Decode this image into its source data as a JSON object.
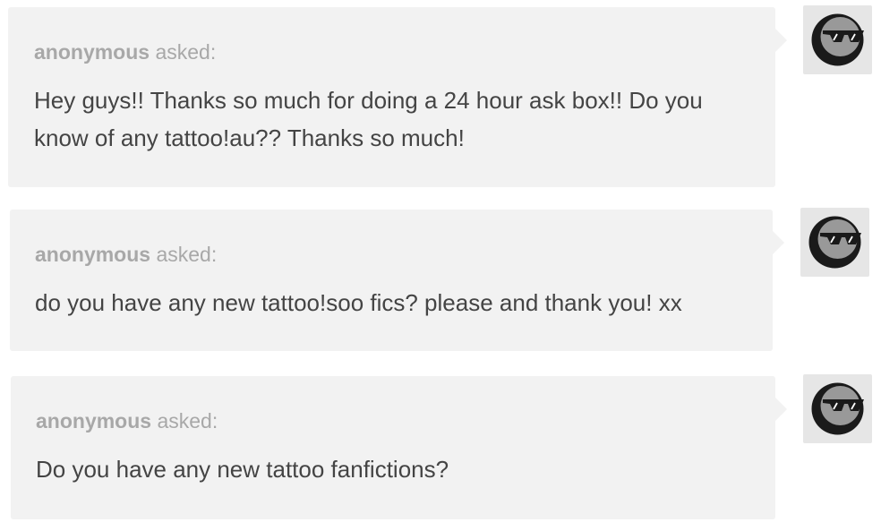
{
  "asks": [
    {
      "asker": "anonymous",
      "asked_label": " asked:",
      "question": "Hey guys!! Thanks so much for doing a 24 hour ask box!! Do you know of any tattoo!au?? Thanks so much!"
    },
    {
      "asker": "anonymous",
      "asked_label": " asked:",
      "question": "do you have any new tattoo!soo fics? please and thank you! xx"
    },
    {
      "asker": "anonymous",
      "asked_label": " asked:",
      "question": "Do you have any new tattoo fanfictions?"
    }
  ],
  "avatar_icon": "anonymous-sunglasses-avatar-icon",
  "colors": {
    "bubble": "#f2f2f2",
    "asker_text": "#a8a8a8",
    "question_text": "#444444",
    "avatar_bg": "#e6e6e6",
    "avatar_face": "#999999",
    "avatar_dark": "#1a1a1a"
  }
}
